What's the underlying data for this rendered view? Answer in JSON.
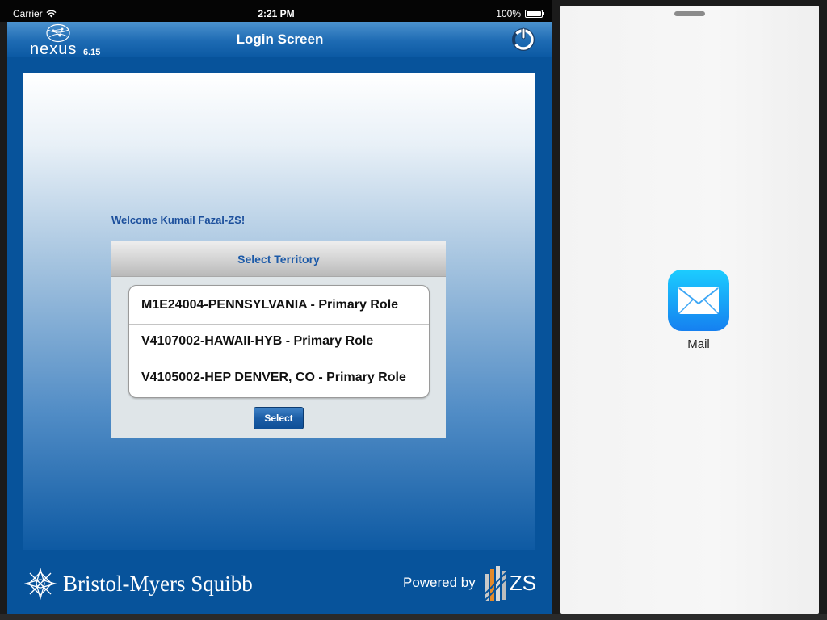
{
  "status_bar": {
    "carrier": "Carrier",
    "time": "2:21 PM",
    "battery": "100%",
    "battery_level": 1.0
  },
  "header": {
    "app_name": "nexus",
    "version": "6.15",
    "title": "Login Screen",
    "power_icon": "power-icon"
  },
  "main": {
    "welcome": "Welcome Kumail Fazal-ZS!",
    "panel_title": "Select Territory",
    "territories": [
      "M1E24004-PENNSYLVANIA - Primary Role",
      "V4107002-HAWAII-HYB - Primary Role",
      "V4105002-HEP DENVER, CO - Primary Role"
    ],
    "select_button": "Select"
  },
  "footer": {
    "company": "Bristol-Myers Squibb",
    "powered_by": "Powered by",
    "zs": "ZS"
  },
  "slideover": {
    "app_label": "Mail",
    "app_icon": "mail-icon"
  },
  "colors": {
    "brand_blue": "#07539b",
    "header_blue": "#1e6bb3",
    "title_text": "#1c5aa8",
    "mail_gradient_top": "#1ccdff",
    "mail_gradient_bottom": "#1580f0"
  }
}
